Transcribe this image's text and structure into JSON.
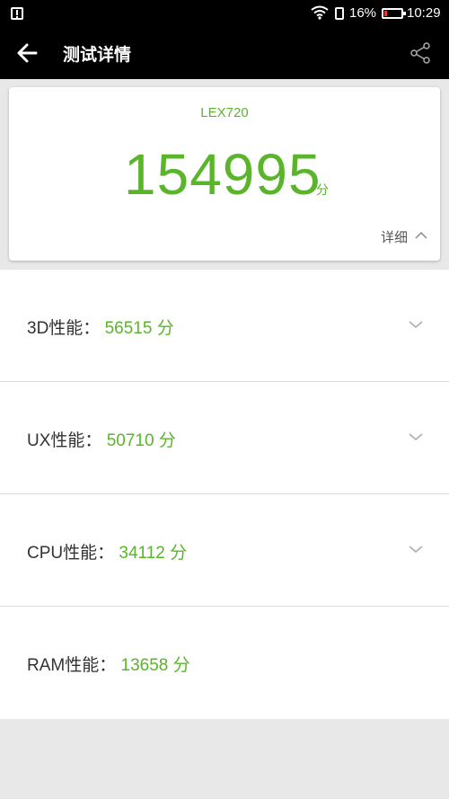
{
  "status_bar": {
    "battery_text": "16%",
    "battery_level": 0.16,
    "time": "10:29"
  },
  "app_bar": {
    "title": "测试详情",
    "back_icon": "arrow-left-icon",
    "share_icon": "share-icon"
  },
  "score_card": {
    "device": "LEX720",
    "total_score": "154995",
    "unit": "分",
    "detail_label": "详细"
  },
  "colors": {
    "accent_green": "#5ab52b",
    "battery_low": "#e53935"
  },
  "results": [
    {
      "label": "3D性能：",
      "score": "56515 分",
      "expandable": true
    },
    {
      "label": "UX性能：",
      "score": "50710 分",
      "expandable": true
    },
    {
      "label": "CPU性能：",
      "score": "34112 分",
      "expandable": true
    },
    {
      "label": "RAM性能：",
      "score": "13658 分",
      "expandable": false
    }
  ]
}
